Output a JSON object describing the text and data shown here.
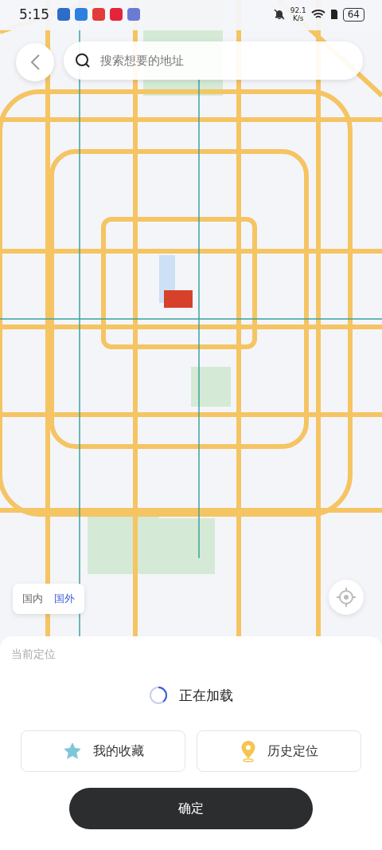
{
  "status_bar": {
    "time": "5:15",
    "net_speed": "92.1",
    "net_unit": "K/s",
    "battery": "64"
  },
  "search": {
    "placeholder": "搜索想要的地址"
  },
  "region_tabs": [
    {
      "label": "国内",
      "selected": false
    },
    {
      "label": "国外",
      "selected": true
    }
  ],
  "sheet": {
    "title": "当前定位",
    "loading": "正在加载",
    "shortcuts": [
      {
        "kind": "favorites",
        "label": "我的收藏"
      },
      {
        "kind": "history",
        "label": "历史定位"
      }
    ],
    "confirm": "确定"
  }
}
